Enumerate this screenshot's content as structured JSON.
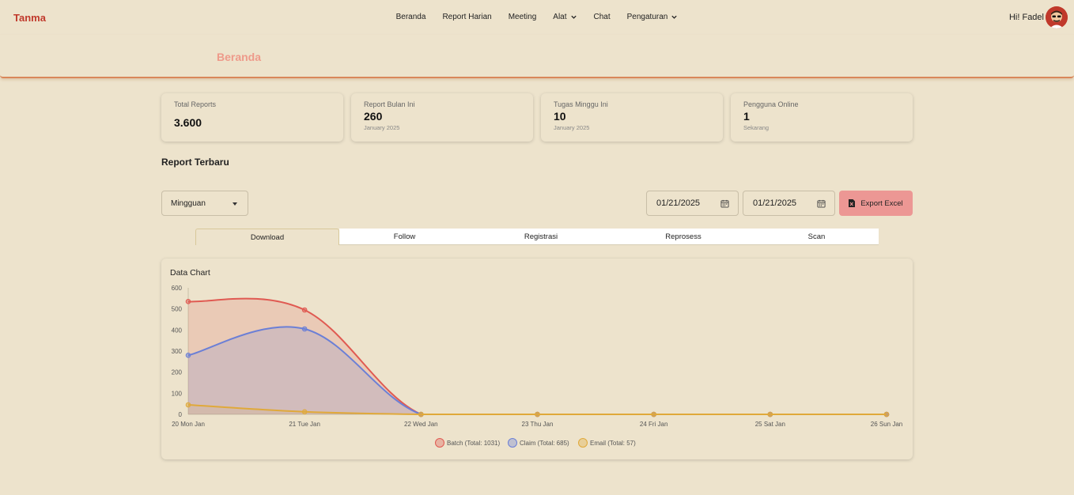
{
  "app": {
    "brand": "Tanma",
    "greeting": "Hi! Fadel"
  },
  "nav": {
    "items": [
      {
        "label": "Beranda",
        "dropdown": false
      },
      {
        "label": "Report Harian",
        "dropdown": false
      },
      {
        "label": "Meeting",
        "dropdown": false
      },
      {
        "label": "Alat",
        "dropdown": true
      },
      {
        "label": "Chat",
        "dropdown": false
      },
      {
        "label": "Pengaturan",
        "dropdown": true
      }
    ]
  },
  "page": {
    "title": "Beranda"
  },
  "stats": [
    {
      "label": "Total Reports",
      "value": "3.600",
      "sub": ""
    },
    {
      "label": "Report Bulan Ini",
      "value": "260",
      "sub": "January 2025"
    },
    {
      "label": "Tugas Minggu Ini",
      "value": "10",
      "sub": "January 2025"
    },
    {
      "label": "Pengguna Online",
      "value": "1",
      "sub": "Sekarang"
    }
  ],
  "section": {
    "title": "Report Terbaru"
  },
  "filters": {
    "period": "Mingguan",
    "date_from": "01/21/2025",
    "date_to": "01/21/2025",
    "export_label": "Export Excel"
  },
  "tabs": [
    {
      "label": "Download",
      "active": true
    },
    {
      "label": "Follow",
      "active": false
    },
    {
      "label": "Registrasi",
      "active": false
    },
    {
      "label": "Reprosess",
      "active": false
    },
    {
      "label": "Scan",
      "active": false
    }
  ],
  "chart_data": {
    "type": "area",
    "title": "Data Chart",
    "categories": [
      "20 Mon Jan",
      "21 Tue Jan",
      "22 Wed Jan",
      "23 Thu Jan",
      "24 Fri Jan",
      "25 Sat Jan",
      "26 Sun Jan"
    ],
    "ylim": [
      0,
      600
    ],
    "yticks": [
      0,
      100,
      200,
      300,
      400,
      500,
      600
    ],
    "legend_position": "bottom",
    "series": [
      {
        "name": "Batch (Total: 1031)",
        "values": [
          535,
          495,
          0,
          0,
          0,
          0,
          0
        ],
        "color": "#e05a52"
      },
      {
        "name": "Claim (Total: 685)",
        "values": [
          280,
          405,
          0,
          0,
          0,
          0,
          0
        ],
        "color": "#6b7fd6"
      },
      {
        "name": "Email (Total: 57)",
        "values": [
          45,
          12,
          0,
          0,
          0,
          0,
          0
        ],
        "color": "#e0a93a"
      }
    ]
  },
  "colors": {
    "background": "#ede3cc",
    "brand": "#c0392b",
    "accent": "#ec9794",
    "header_border": "#d9875a"
  }
}
